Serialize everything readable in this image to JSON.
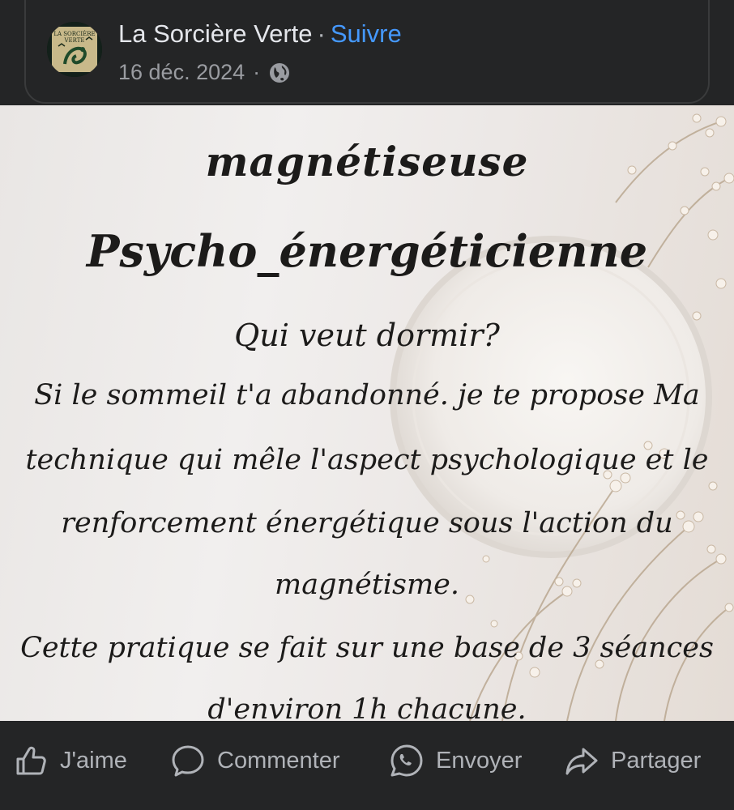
{
  "header": {
    "page_name": "La Sorcière Verte",
    "separator": "·",
    "follow_label": "Suivre",
    "date": "16 déc. 2024",
    "meta_separator": "·",
    "audience_icon": "globe-icon",
    "avatar_text_line1": "LA SORCIÈRE",
    "avatar_text_line2": "VERTE"
  },
  "post_image": {
    "title": "magnétiseuse",
    "subtitle": "Psycho_énergéticienne",
    "question": "Qui veut dormir?",
    "lines": [
      "Si le sommeil t'a abandonné. je te propose Ma",
      "technique qui mêle l'aspect psychologique et le",
      "renforcement énergétique sous l'action du",
      "magnétisme.",
      "Cette pratique se fait sur une base de 3 séances",
      "d'environ 1h chacune."
    ]
  },
  "actions": {
    "like": {
      "label": "J'aime",
      "icon": "thumbs-up-icon"
    },
    "comment": {
      "label": "Commenter",
      "icon": "comment-bubble-icon"
    },
    "send": {
      "label": "Envoyer",
      "icon": "whatsapp-icon"
    },
    "share": {
      "label": "Partager",
      "icon": "share-arrow-icon"
    }
  },
  "colors": {
    "background": "#242526",
    "follow_link": "#4599ff",
    "primary_text": "#e4e6eb",
    "secondary_text": "#b0b3b8"
  }
}
